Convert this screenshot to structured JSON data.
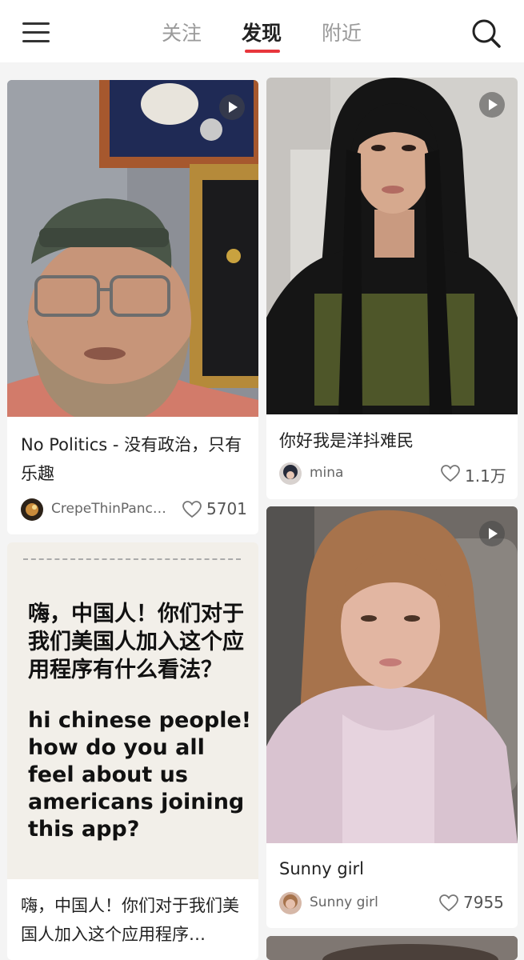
{
  "header": {
    "tabs": [
      {
        "label": "关注",
        "active": false
      },
      {
        "label": "发现",
        "active": true
      },
      {
        "label": "附近",
        "active": false
      }
    ],
    "accent_color": "#e8363c"
  },
  "feed": {
    "cards": [
      {
        "title": "No Politics - 没有政治，只有乐趣",
        "author": "CrepeThinPanc…",
        "likes": "5701",
        "has_video": true
      },
      {
        "title": "你好我是洋抖难民",
        "author": "mina",
        "likes": "1.1万",
        "has_video": true
      },
      {
        "image_text_zh": "嗨，中国人！你们对于我们美国人加入这个应用程序有什么看法？",
        "image_text_en": "hi chinese people! how do you all feel about us americans joining this app?",
        "title": "嗨，中国人！你们对于我们美国人加入这个应用程序…",
        "has_video": false
      },
      {
        "title": "Sunny girl",
        "author": "Sunny girl",
        "likes": "7955",
        "has_video": true
      }
    ]
  }
}
